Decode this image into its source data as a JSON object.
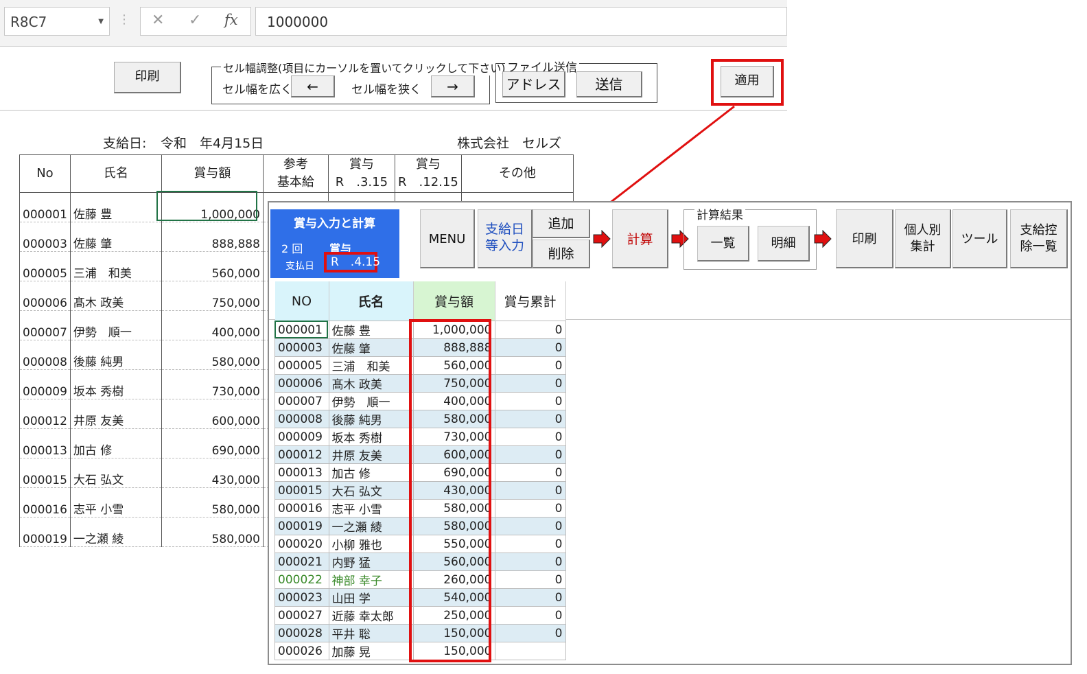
{
  "formula_bar": {
    "name_box": "R8C7",
    "cancel_icon": "✕",
    "enter_icon": "✓",
    "fx_label": "fx",
    "value": "1000000"
  },
  "toolbar": {
    "print_label": "印刷",
    "width_group_label": "セル幅調整(項目にカーソルを置いてクリックして下さい)",
    "widen_label": "セル幅を広く",
    "widen_arrow": "←",
    "narrow_label": "セル幅を狭く",
    "narrow_arrow": "→",
    "file_group_label": "ファイル送信",
    "address_label": "アドレス",
    "send_label": "送信",
    "apply_label": "適用"
  },
  "sheet": {
    "pay_date_label": "支給日:",
    "pay_date_value": "令和　年4月15日",
    "company": "株式会社　セルズ",
    "headers": {
      "no": "No",
      "name": "氏名",
      "bonus": "賞与額",
      "ref_base_1": "参考",
      "ref_base_2": "基本給",
      "bonus1_1": "賞与",
      "bonus1_2": "R　.3.15",
      "bonus2_1": "賞与",
      "bonus2_2": "R　.12.15",
      "other": "その他"
    },
    "rows": [
      {
        "no": "000001",
        "name": "佐藤 豊",
        "amount": "1,000,000"
      },
      {
        "no": "000003",
        "name": "佐藤 肇",
        "amount": "888,888"
      },
      {
        "no": "000005",
        "name": "三浦　和美",
        "amount": "560,000"
      },
      {
        "no": "000006",
        "name": "髙木 政美",
        "amount": "750,000"
      },
      {
        "no": "000007",
        "name": "伊勢　順一",
        "amount": "400,000"
      },
      {
        "no": "000008",
        "name": "後藤 純男",
        "amount": "580,000"
      },
      {
        "no": "000009",
        "name": "坂本 秀樹",
        "amount": "730,000"
      },
      {
        "no": "000012",
        "name": "井原 友美",
        "amount": "600,000"
      },
      {
        "no": "000013",
        "name": "加古 修",
        "amount": "690,000"
      },
      {
        "no": "000015",
        "name": "大石 弘文",
        "amount": "430,000"
      },
      {
        "no": "000016",
        "name": "志平 小雪",
        "amount": "580,000"
      },
      {
        "no": "000019",
        "name": "一之瀬 綾",
        "amount": "580,000"
      }
    ]
  },
  "app": {
    "title": "賞与入力と計算",
    "round": "2 回",
    "kind": "賞与",
    "pay_date_label": "支払日",
    "pay_date_value": "R　.4.15",
    "menu_label": "MENU",
    "date_input_1": "支給日",
    "date_input_2": "等入力",
    "add_label": "追加",
    "delete_label": "削除",
    "calc_label": "計算",
    "result_group_label": "計算結果",
    "list_label": "一覧",
    "detail_label": "明細",
    "print_label": "印刷",
    "personal_1": "個人別",
    "personal_2": "集計",
    "tools_label": "ツール",
    "deduct_1": "支給控",
    "deduct_2": "除一覧",
    "headers": {
      "no": "NO",
      "name": "氏名",
      "bonus": "賞与額",
      "cumulative": "賞与累計"
    },
    "rows": [
      {
        "no": "000001",
        "name": "佐藤 豊",
        "amount": "1,000,000",
        "cum": "0"
      },
      {
        "no": "000003",
        "name": "佐藤 肇",
        "amount": "888,888",
        "cum": "0"
      },
      {
        "no": "000005",
        "name": "三浦　和美",
        "amount": "560,000",
        "cum": "0"
      },
      {
        "no": "000006",
        "name": "髙木 政美",
        "amount": "750,000",
        "cum": "0"
      },
      {
        "no": "000007",
        "name": "伊勢　順一",
        "amount": "400,000",
        "cum": "0"
      },
      {
        "no": "000008",
        "name": "後藤 純男",
        "amount": "580,000",
        "cum": "0"
      },
      {
        "no": "000009",
        "name": "坂本 秀樹",
        "amount": "730,000",
        "cum": "0"
      },
      {
        "no": "000012",
        "name": "井原 友美",
        "amount": "600,000",
        "cum": "0"
      },
      {
        "no": "000013",
        "name": "加古 修",
        "amount": "690,000",
        "cum": "0"
      },
      {
        "no": "000015",
        "name": "大石 弘文",
        "amount": "430,000",
        "cum": "0"
      },
      {
        "no": "000016",
        "name": "志平 小雪",
        "amount": "580,000",
        "cum": "0"
      },
      {
        "no": "000019",
        "name": "一之瀬 綾",
        "amount": "580,000",
        "cum": "0"
      },
      {
        "no": "000020",
        "name": "小柳 雅也",
        "amount": "550,000",
        "cum": "0"
      },
      {
        "no": "000021",
        "name": "内野 猛",
        "amount": "560,000",
        "cum": "0"
      },
      {
        "no": "000022",
        "name": "神部 幸子",
        "amount": "260,000",
        "cum": "0"
      },
      {
        "no": "000023",
        "name": "山田 学",
        "amount": "540,000",
        "cum": "0"
      },
      {
        "no": "000027",
        "name": "近藤 幸太郎",
        "amount": "250,000",
        "cum": "0"
      },
      {
        "no": "000028",
        "name": "平井 聡",
        "amount": "150,000",
        "cum": "0"
      },
      {
        "no": "000026",
        "name": "加藤 晃",
        "amount": "150,000",
        "cum": ""
      }
    ]
  },
  "colors": {
    "highlight_red": "#e01010",
    "app_blue": "#2f6fe8",
    "header_cyan": "#d9f4fb",
    "header_green": "#d7f5d2",
    "alt_row": "#ddecf4",
    "calc_red": "#c00000",
    "nav_blue": "#1f4fbf"
  }
}
